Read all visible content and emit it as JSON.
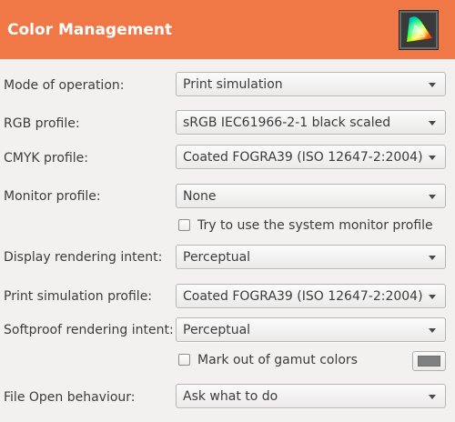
{
  "header": {
    "title": "Color Management",
    "icon": "color-gamut-icon"
  },
  "rows": {
    "mode": {
      "label": "Mode of operation:",
      "value": "Print simulation"
    },
    "rgb": {
      "label": "RGB profile:",
      "value": "sRGB IEC61966-2-1 black scaled"
    },
    "cmyk": {
      "label": "CMYK profile:",
      "value": "Coated FOGRA39 (ISO 12647-2:2004)"
    },
    "monitor": {
      "label": "Monitor profile:",
      "value": "None"
    },
    "system_monitor": {
      "label": "Try to use the system monitor profile",
      "checked": false
    },
    "display_intent": {
      "label": "Display rendering intent:",
      "value": "Perceptual"
    },
    "print_sim": {
      "label": "Print simulation profile:",
      "value": "Coated FOGRA39 (ISO 12647-2:2004)"
    },
    "softproof_intent": {
      "label": "Softproof rendering intent:",
      "value": "Perceptual"
    },
    "gamut": {
      "label": "Mark out of gamut colors",
      "checked": false,
      "color": "#808080"
    },
    "file_open": {
      "label": "File Open behaviour:",
      "value": "Ask what to do"
    }
  },
  "colors": {
    "header_bg": "#f07746",
    "window_bg": "#f2f1f0",
    "text": "#3c3c3c"
  }
}
